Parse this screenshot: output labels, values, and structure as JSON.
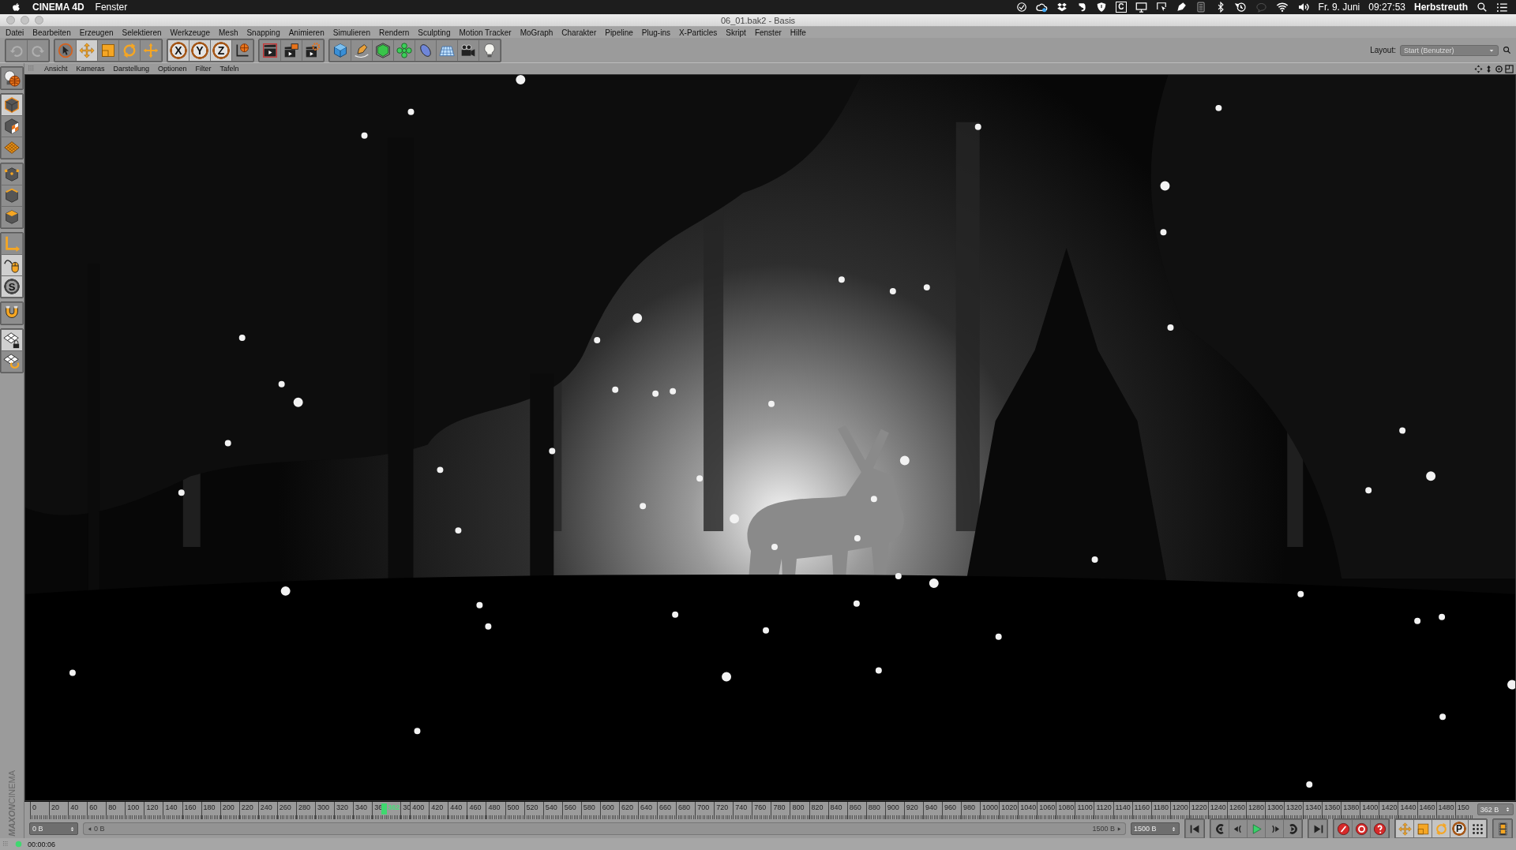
{
  "menubar": {
    "app": "CINEMA 4D",
    "menus": [
      "Fenster"
    ],
    "status_badge": "C",
    "date": "Fr. 9. Juni",
    "time": "09:27:53",
    "user": "Herbstreuth"
  },
  "window": {
    "title": "06_01.bak2 - Basis"
  },
  "menu": [
    "Datei",
    "Bearbeiten",
    "Erzeugen",
    "Selektieren",
    "Werkzeuge",
    "Mesh",
    "Snapping",
    "Animieren",
    "Simulieren",
    "Rendern",
    "Sculpting",
    "Motion Tracker",
    "MoGraph",
    "Charakter",
    "Pipeline",
    "Plug-ins",
    "X-Particles",
    "Skript",
    "Fenster",
    "Hilfe"
  ],
  "layout": {
    "label": "Layout:",
    "value": "Start (Benutzer)"
  },
  "toolbar": [
    [
      {
        "kind": "undo",
        "selected": false
      },
      {
        "kind": "redo",
        "selected": false
      }
    ],
    [
      {
        "kind": "select",
        "selected": false
      },
      {
        "kind": "move",
        "selected": true
      },
      {
        "kind": "scale",
        "selected": false
      },
      {
        "kind": "rotate",
        "selected": false
      },
      {
        "kind": "add",
        "selected": false
      }
    ],
    [
      {
        "kind": "axis",
        "label": "X",
        "selected": true
      },
      {
        "kind": "axis",
        "label": "Y",
        "selected": true
      },
      {
        "kind": "axis",
        "label": "Z",
        "selected": true
      },
      {
        "kind": "coord",
        "selected": false
      }
    ],
    [
      {
        "kind": "render-view",
        "selected": false
      },
      {
        "kind": "render-pv",
        "selected": false
      },
      {
        "kind": "render-settings",
        "selected": false
      }
    ],
    [
      {
        "kind": "cube",
        "selected": false
      },
      {
        "kind": "pen",
        "selected": false
      },
      {
        "kind": "subdiv",
        "selected": false
      },
      {
        "kind": "cloner",
        "selected": false
      },
      {
        "kind": "deformer",
        "selected": false
      },
      {
        "kind": "floor",
        "selected": false
      },
      {
        "kind": "camera",
        "selected": false
      },
      {
        "kind": "light",
        "selected": false
      }
    ]
  ],
  "viewport": {
    "menu": [
      "Ansicht",
      "Kameras",
      "Darstellung",
      "Optionen",
      "Filter",
      "Tafeln"
    ]
  },
  "left_tools": [
    [
      {
        "kind": "edit-render",
        "selected": false
      }
    ],
    [
      {
        "kind": "model",
        "selected": true
      },
      {
        "kind": "texture",
        "selected": false
      },
      {
        "kind": "workplane",
        "selected": false
      }
    ],
    [
      {
        "kind": "points",
        "selected": false
      },
      {
        "kind": "edges",
        "selected": false
      },
      {
        "kind": "polys",
        "selected": false
      }
    ],
    [
      {
        "kind": "axis",
        "selected": false
      },
      {
        "kind": "tweak",
        "selected": true
      },
      {
        "kind": "solo",
        "label": "S",
        "selected": true
      }
    ],
    [
      {
        "kind": "snap",
        "selected": false
      }
    ],
    [
      {
        "kind": "lockwp",
        "selected": true
      },
      {
        "kind": "wprotate",
        "selected": false
      }
    ]
  ],
  "logo": {
    "brand": "MAXON",
    "product": "CINEMA"
  },
  "timeline": {
    "ticks_before": [
      "0",
      "20",
      "40",
      "60",
      "80",
      "100",
      "120",
      "140",
      "160",
      "180",
      "200",
      "220",
      "240",
      "260",
      "280",
      "300",
      "320",
      "340",
      "36"
    ],
    "playhead": "362",
    "ticks_after": [
      "30",
      "400",
      "420",
      "440",
      "460",
      "480",
      "500",
      "520",
      "540",
      "560",
      "580",
      "600",
      "620",
      "640",
      "660",
      "680",
      "700",
      "720",
      "740",
      "760",
      "780",
      "800",
      "820",
      "840",
      "860",
      "880",
      "900",
      "920",
      "940",
      "960",
      "980",
      "1000",
      "1020",
      "1040",
      "1060",
      "1080",
      "1100",
      "1120",
      "1140",
      "1160",
      "1180",
      "1200",
      "1220",
      "1240",
      "1260",
      "1280",
      "1300",
      "1320",
      "1340",
      "1360",
      "1380",
      "1400",
      "1420",
      "1440",
      "1460",
      "1480",
      "150"
    ],
    "current_field": "362 B"
  },
  "range": {
    "level": 1,
    "start_field": "0 B",
    "min_label": "0 B",
    "max_label": "1500 B",
    "end_field": "1500 B"
  },
  "transport": [
    [
      {
        "kind": "first"
      }
    ],
    [
      {
        "kind": "prevkey"
      },
      {
        "kind": "prev"
      },
      {
        "kind": "play"
      },
      {
        "kind": "next"
      },
      {
        "kind": "nextkey"
      }
    ],
    [
      {
        "kind": "last"
      }
    ],
    [
      {
        "kind": "record"
      },
      {
        "kind": "autokey"
      },
      {
        "kind": "keysel"
      }
    ],
    [
      {
        "kind": "move"
      },
      {
        "kind": "scale"
      },
      {
        "kind": "rotate"
      },
      {
        "kind": "param",
        "label": "P"
      },
      {
        "kind": "dots"
      }
    ],
    [
      {
        "kind": "film"
      }
    ]
  ],
  "status": {
    "time": "00:00:06"
  }
}
